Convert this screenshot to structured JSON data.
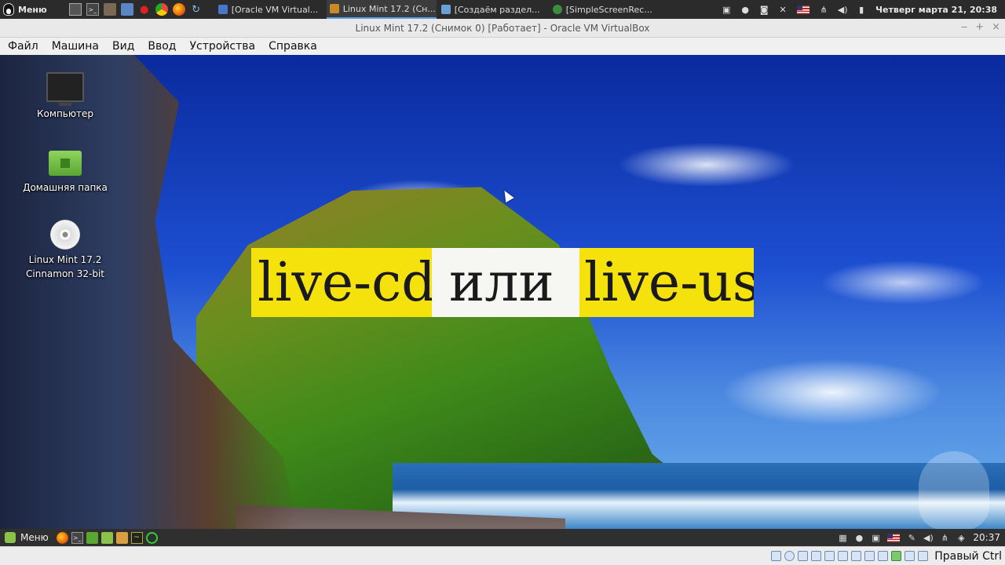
{
  "host_panel": {
    "menu_label": "Меню",
    "launchers": [
      "terminal-icon",
      "monitor-icon",
      "camera-icon",
      "files-icon",
      "cherry-icon",
      "chrome-icon",
      "firefox-icon",
      "refresh-icon"
    ],
    "tasks": [
      {
        "label": "[Oracle VM Virtual...",
        "active": false,
        "color": "#4a76c9"
      },
      {
        "label": "Linux Mint 17.2 (Сн...",
        "active": true,
        "color": "#c88a2a"
      },
      {
        "label": "[Создаём раздел...",
        "active": false,
        "color": "#6aa0d8"
      },
      {
        "label": "[SimpleScreenRec...",
        "active": false,
        "color": "#3b8d3b"
      }
    ],
    "clock": "Четверг марта 21, 20:38"
  },
  "vbox": {
    "title": "Linux Mint 17.2 (Снимок 0) [Работает] - Oracle VM VirtualBox",
    "window_controls": [
      "‒",
      "+",
      "×"
    ],
    "menu": [
      "Файл",
      "Машина",
      "Вид",
      "Ввод",
      "Устройства",
      "Справка"
    ],
    "host_key": "Правый Ctrl"
  },
  "desktop_icons": [
    {
      "label": "Компьютер",
      "icon": "computer-icon"
    },
    {
      "label": "Домашняя папка",
      "icon": "home-folder-icon"
    },
    {
      "label_line1": "Linux Mint 17.2",
      "label_line2": "Cinnamon 32-bit",
      "icon": "disc-icon"
    }
  ],
  "overlay": {
    "part1": "live-cd",
    "part2": "или",
    "part3": "live-usb",
    "highlight_color": "#f5e20c"
  },
  "guest_panel": {
    "menu_label": "Меню",
    "clock": "20:37"
  }
}
